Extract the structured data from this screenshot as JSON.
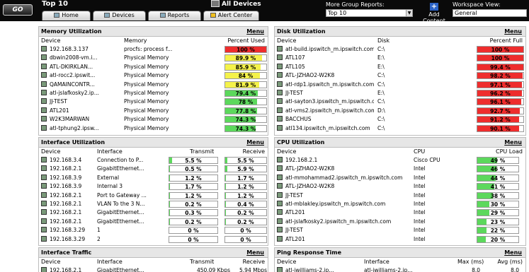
{
  "header": {
    "go_label": "GO",
    "title": "Top 10",
    "all_devices": "All Devices",
    "tabs": [
      {
        "label": "Home",
        "icon": "home-icon"
      },
      {
        "label": "Devices",
        "icon": "devices-icon"
      },
      {
        "label": "Reports",
        "icon": "reports-icon"
      },
      {
        "label": "Alert Center",
        "icon": "alert-icon"
      }
    ],
    "more_group_reports_label": "More Group Reports:",
    "more_group_reports_value": "Top 10",
    "add_content_label": "Add Content",
    "workspace_view_label": "Workspace View:",
    "workspace_view_value": "General"
  },
  "colors": {
    "red": "#ee2d2d",
    "yellow": "#f4f24a",
    "green": "#5cd85c"
  },
  "panels": {
    "memory": {
      "title": "Memory Utilization",
      "menu": "Menu",
      "columns": [
        "Device",
        "Memory",
        "Percent Used"
      ],
      "rows": [
        {
          "device": "192.168.3.137",
          "detail": "procfs: process f...",
          "value": "100 %",
          "pct": 100,
          "color": "red"
        },
        {
          "device": "dbwin2008-vm.i...",
          "detail": "Physical Memory",
          "value": "89.9 %",
          "pct": 89.9,
          "color": "yellow"
        },
        {
          "device": "ATL-DKIRKLAN...",
          "detail": "Physical Memory",
          "value": "85.9 %",
          "pct": 85.9,
          "color": "yellow"
        },
        {
          "device": "atl-rocc2.ipswit...",
          "detail": "Physical Memory",
          "value": "84 %",
          "pct": 84,
          "color": "yellow"
        },
        {
          "device": "QAMAINCONTR...",
          "detail": "Physical Memory",
          "value": "81.9 %",
          "pct": 81.9,
          "color": "yellow"
        },
        {
          "device": "atl-jslafkosky2.ip...",
          "detail": "Physical Memory",
          "value": "79.4 %",
          "pct": 79.4,
          "color": "green"
        },
        {
          "device": "JJ-TEST",
          "detail": "Physical Memory",
          "value": "78 %",
          "pct": 78,
          "color": "green"
        },
        {
          "device": "ATL201",
          "detail": "Physical Memory",
          "value": "77.8 %",
          "pct": 77.8,
          "color": "green"
        },
        {
          "device": "W2K3MARWAN",
          "detail": "Physical Memory",
          "value": "74.3 %",
          "pct": 74.3,
          "color": "green"
        },
        {
          "device": "atl-tphung2.ipsw...",
          "detail": "Physical Memory",
          "value": "74.3 %",
          "pct": 74.3,
          "color": "green"
        }
      ]
    },
    "disk": {
      "title": "Disk Utilization",
      "menu": "Menu",
      "columns": [
        "Device",
        "Disk",
        "Percent Full"
      ],
      "rows": [
        {
          "device": "atl-build.ipswitch_m.ipswitch.com",
          "detail": "C:\\",
          "value": "100 %",
          "pct": 100,
          "color": "red"
        },
        {
          "device": "ATL107",
          "detail": "E:\\",
          "value": "100 %",
          "pct": 100,
          "color": "red"
        },
        {
          "device": "ATL105",
          "detail": "E:\\",
          "value": "99.4 %",
          "pct": 99.4,
          "color": "red"
        },
        {
          "device": "ATL-JZHAO2-W2K8",
          "detail": "C:\\",
          "value": "98.2 %",
          "pct": 98.2,
          "color": "red"
        },
        {
          "device": "atl-rdp1.ipswitch_m.ipswitch.com",
          "detail": "C:\\",
          "value": "97.1 %",
          "pct": 97.1,
          "color": "red"
        },
        {
          "device": "JJ-TEST",
          "detail": "E:\\",
          "value": "96.2 %",
          "pct": 96.2,
          "color": "red"
        },
        {
          "device": "atl-sayton3.ipswitch_m.ipswitch.com",
          "detail": "C:\\",
          "value": "96.1 %",
          "pct": 96.1,
          "color": "red"
        },
        {
          "device": "atl-vms2.ipswitch_m.ipswitch.com",
          "detail": "D:\\",
          "value": "92.7 %",
          "pct": 92.7,
          "color": "red"
        },
        {
          "device": "BACCHUS",
          "detail": "C:\\",
          "value": "91.2 %",
          "pct": 91.2,
          "color": "red"
        },
        {
          "device": "atl134.ipswitch_m.ipswitch.com",
          "detail": "C:\\",
          "value": "90.1 %",
          "pct": 90.1,
          "color": "red"
        }
      ]
    },
    "interface": {
      "title": "Interface Utilization",
      "menu": "Menu",
      "columns": [
        "Device",
        "Interface",
        "Transmit",
        "Receive"
      ],
      "rows": [
        {
          "device": "192.168.3.4",
          "detail": "Connection to P...",
          "tx": "5.5 %",
          "tx_pct": 5.5,
          "rx": "5.5 %",
          "rx_pct": 5.5
        },
        {
          "device": "192.168.2.1",
          "detail": "GigabitEthernet...",
          "tx": "0.5 %",
          "tx_pct": 0.5,
          "rx": "5.9 %",
          "rx_pct": 5.9
        },
        {
          "device": "192.168.3.9",
          "detail": "External",
          "tx": "1.2 %",
          "tx_pct": 1.2,
          "rx": "1.7 %",
          "rx_pct": 1.7
        },
        {
          "device": "192.168.3.9",
          "detail": "Internal 3",
          "tx": "1.7 %",
          "tx_pct": 1.7,
          "rx": "1.2 %",
          "rx_pct": 1.2
        },
        {
          "device": "192.168.2.1",
          "detail": "Port to Gateway ...",
          "tx": "1.2 %",
          "tx_pct": 1.2,
          "rx": "1.2 %",
          "rx_pct": 1.2
        },
        {
          "device": "192.168.2.1",
          "detail": "VLAN To the 3 N...",
          "tx": "0.2 %",
          "tx_pct": 0.2,
          "rx": "0.4 %",
          "rx_pct": 0.4
        },
        {
          "device": "192.168.2.1",
          "detail": "GigabitEthernet...",
          "tx": "0.3 %",
          "tx_pct": 0.3,
          "rx": "0.2 %",
          "rx_pct": 0.2
        },
        {
          "device": "192.168.2.1",
          "detail": "GigabitEthernet...",
          "tx": "0.2 %",
          "tx_pct": 0.2,
          "rx": "0.2 %",
          "rx_pct": 0.2
        },
        {
          "device": "192.168.3.29",
          "detail": "1",
          "tx": "0 %",
          "tx_pct": 0,
          "rx": "0 %",
          "rx_pct": 0
        },
        {
          "device": "192.168.3.29",
          "detail": "2",
          "tx": "0 %",
          "tx_pct": 0,
          "rx": "0 %",
          "rx_pct": 0
        }
      ]
    },
    "cpu": {
      "title": "CPU Utilization",
      "menu": "Menu",
      "columns": [
        "Device",
        "CPU",
        "CPU Load"
      ],
      "rows": [
        {
          "device": "192.168.2.1",
          "detail": "Cisco CPU",
          "value": "49 %",
          "pct": 49,
          "color": "green"
        },
        {
          "device": "ATL-JZHAO2-W2K8",
          "detail": "Intel",
          "value": "46 %",
          "pct": 46,
          "color": "green"
        },
        {
          "device": "atl-mmohammad2.ipswitch_m.ipswitch.com",
          "detail": "Intel",
          "value": "44 %",
          "pct": 44,
          "color": "green"
        },
        {
          "device": "ATL-JZHAO2-W2K8",
          "detail": "Intel",
          "value": "41 %",
          "pct": 41,
          "color": "green"
        },
        {
          "device": "JJ-TEST",
          "detail": "Intel",
          "value": "38 %",
          "pct": 38,
          "color": "green"
        },
        {
          "device": "atl-mblakley.ipswitch_m.ipswitch.com",
          "detail": "Intel",
          "value": "30 %",
          "pct": 30,
          "color": "green"
        },
        {
          "device": "ATL201",
          "detail": "Intel",
          "value": "29 %",
          "pct": 29,
          "color": "green"
        },
        {
          "device": "atl-jslafkosky2.ipswitch_m.ipswitch.com",
          "detail": "Intel",
          "value": "23 %",
          "pct": 23,
          "color": "green"
        },
        {
          "device": "JJ-TEST",
          "detail": "Intel",
          "value": "22 %",
          "pct": 22,
          "color": "green"
        },
        {
          "device": "ATL201",
          "detail": "Intel",
          "value": "20 %",
          "pct": 20,
          "color": "green"
        }
      ]
    },
    "traffic": {
      "title": "Interface Traffic",
      "menu": "Menu",
      "columns": [
        "Device",
        "Interface",
        "Transmit",
        "Receive"
      ],
      "rows": [
        {
          "device": "192.168.2.1",
          "detail": "GigabitEthernet...",
          "tx": "450.09 Kbps",
          "rx": "5.94 Mbps"
        }
      ]
    },
    "ping": {
      "title": "Ping Response Time",
      "menu": "Menu",
      "columns": [
        "Device",
        "Interface",
        "Max (ms)",
        "Avg (ms)"
      ],
      "rows": [
        {
          "device": "atl-jwilliams-2.ip...",
          "detail": "atl-jwilliams-2.ip...",
          "max": "8.0",
          "avg": "8.0"
        }
      ]
    }
  }
}
